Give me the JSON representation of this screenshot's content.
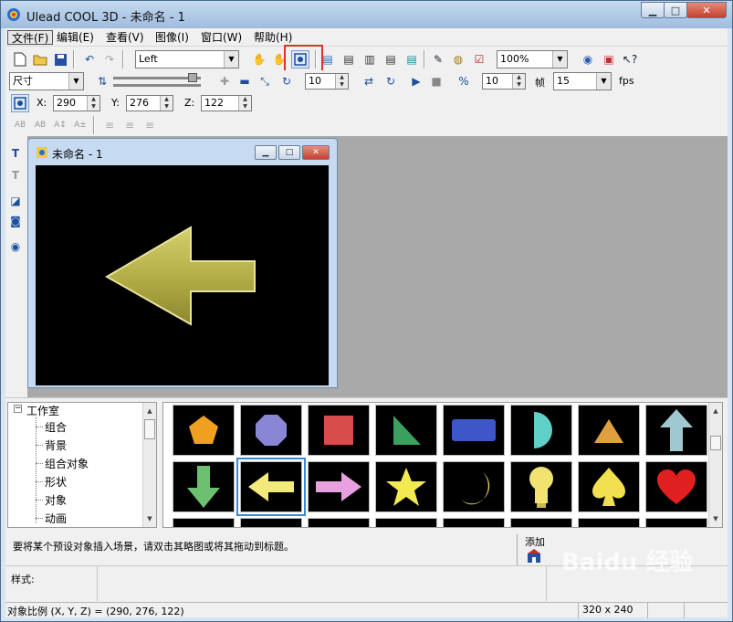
{
  "window": {
    "title": "Ulead COOL 3D - 未命名 - 1"
  },
  "menu": [
    "文件(F)",
    "编辑(E)",
    "查看(V)",
    "图像(I)",
    "窗口(W)",
    "帮助(H)"
  ],
  "toolbar1": {
    "view_select": "Left",
    "zoom_select": "100%"
  },
  "toolbar2": {
    "mode_select": "尺寸",
    "rotate_value": "10",
    "frame_step": "10",
    "frame_label": "帧",
    "fps_value": "15",
    "fps_label": "fps"
  },
  "toolbar3": {
    "x_label": "X:",
    "x_value": "290",
    "y_label": "Y:",
    "y_value": "276",
    "z_label": "Z:",
    "z_value": "122"
  },
  "child_window": {
    "title": "未命名 - 1"
  },
  "tree": {
    "root": "工作室",
    "items": [
      "组合",
      "背景",
      "组合对象",
      "形状",
      "对象",
      "动画"
    ]
  },
  "gallery": {
    "items": [
      {
        "name": "pentagon",
        "color": "#f0a020"
      },
      {
        "name": "octagon",
        "color": "#8a86d6"
      },
      {
        "name": "square",
        "color": "#d84c4c"
      },
      {
        "name": "right-triangle",
        "color": "#3aa060"
      },
      {
        "name": "rounded-rect",
        "color": "#3f56c8"
      },
      {
        "name": "half-circle",
        "color": "#60d0c8"
      },
      {
        "name": "triangle",
        "color": "#e0a040"
      },
      {
        "name": "arrow-up",
        "color": "#a0c8d0"
      },
      {
        "name": "arrow-down",
        "color": "#6cc070"
      },
      {
        "name": "arrow-left",
        "color": "#f2ea7a"
      },
      {
        "name": "arrow-right",
        "color": "#e8a0e0"
      },
      {
        "name": "star",
        "color": "#f2ea50"
      },
      {
        "name": "moon",
        "color": "#e0d060"
      },
      {
        "name": "lightbulb",
        "color": "#f2e270"
      },
      {
        "name": "spade",
        "color": "#f2e050"
      },
      {
        "name": "heart",
        "color": "#e02020"
      }
    ]
  },
  "hint": "要将某个预设对象插入场景，请双击其略图或将其拖动到标题。",
  "add_label": "添加",
  "style_label": "样式:",
  "status": {
    "scale_text": "对象比例 (X, Y, Z) = (290, 276, 122)",
    "size_text": "320 x 240"
  },
  "watermark": "Baidu 经验"
}
